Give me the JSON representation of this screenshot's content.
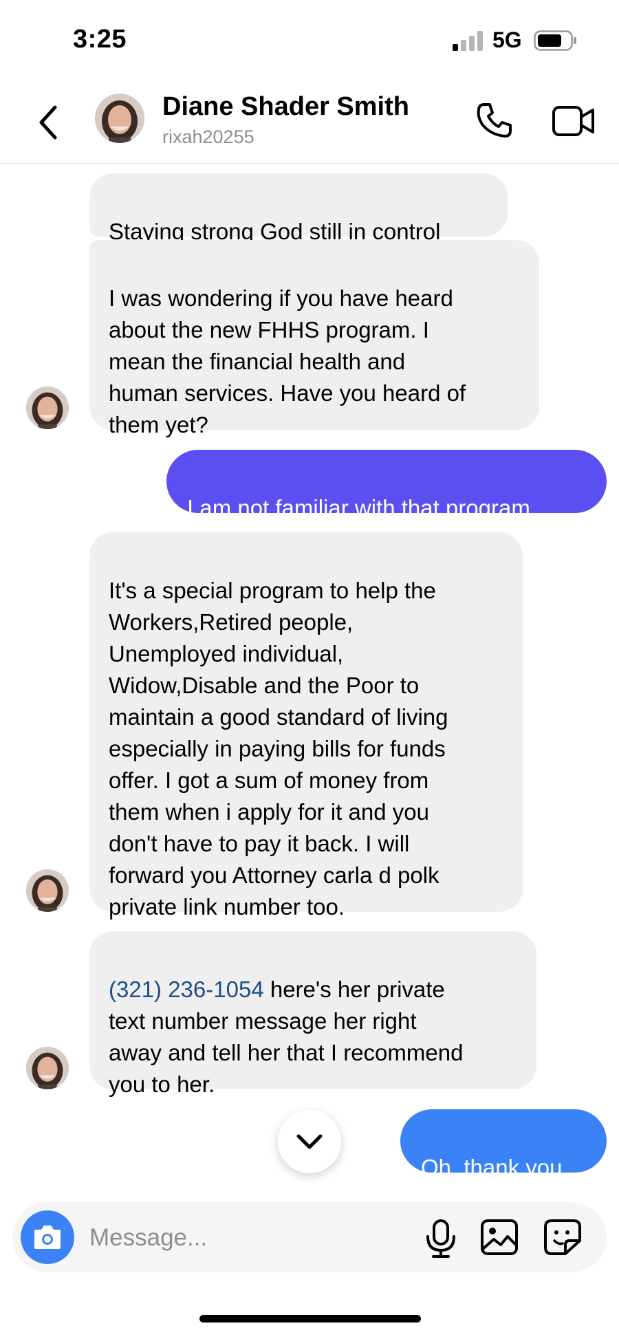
{
  "status_bar": {
    "time": "3:25",
    "network": "5G"
  },
  "header": {
    "name": "Diane Shader Smith",
    "username": "rixah20255"
  },
  "messages": [
    {
      "from": "them",
      "text": "Staying strong God still in control"
    },
    {
      "from": "them",
      "text": "I was wondering if you have heard\nabout the new FHHS program. I\nmean the financial health and\nhuman services. Have you heard of\nthem yet?"
    },
    {
      "from": "me",
      "text": "I am not familiar with that program."
    },
    {
      "from": "them",
      "text": "It's a special program to help the\nWorkers,Retired people,\nUnemployed individual,\nWidow,Disable and the Poor to\nmaintain a good standard of living\nespecially in paying bills for funds\noffer. I got a sum of money from\nthem when i apply for it and you\ndon't have to pay it back. I will\nforward you Attorney carla d polk\nprivate link number too."
    },
    {
      "from": "them",
      "phone": "(321) 236-1054",
      "text": " here's her private\ntext number message her right\naway and tell her that I recommend\nyou to her."
    },
    {
      "from": "me",
      "text": "Oh, thank you."
    }
  ],
  "composer": {
    "placeholder": "Message..."
  },
  "colors": {
    "outgoing_purple": "#5b4ff1",
    "outgoing_blue": "#3b82f6",
    "incoming": "#efefef",
    "link": "#1f4f8a"
  },
  "icons": [
    "back-chevron-icon",
    "phone-icon",
    "video-camera-icon",
    "chevron-down-icon",
    "camera-icon",
    "microphone-icon",
    "gallery-icon",
    "sticker-icon"
  ]
}
